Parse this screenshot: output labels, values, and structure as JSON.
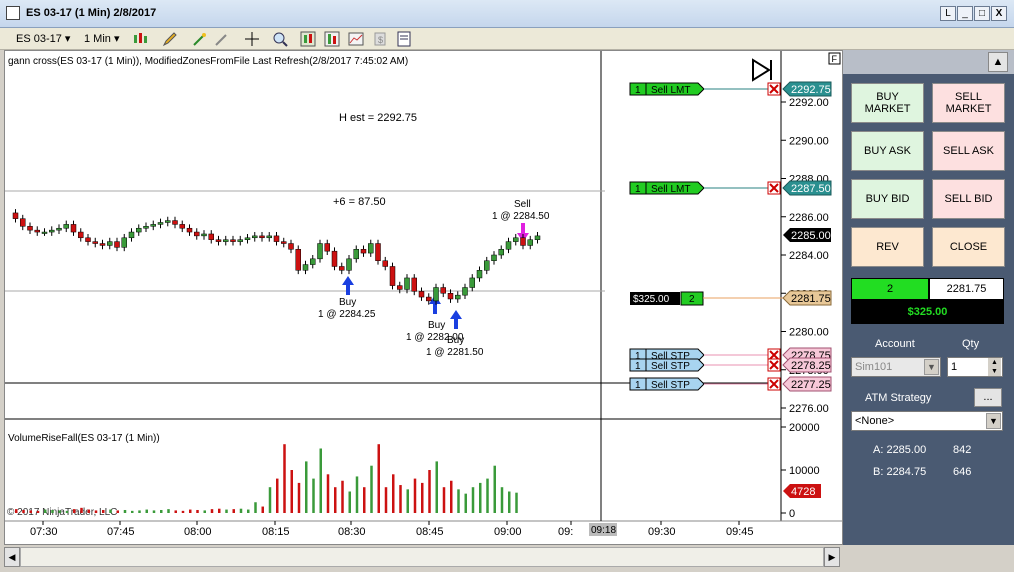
{
  "window": {
    "title": "ES 03-17 (1 Min)  2/8/2017",
    "btn_restore": "L",
    "btn_min": "_",
    "btn_max": "□",
    "btn_close": "X"
  },
  "toolbar": {
    "instrument": "ES 03-17",
    "interval": "1 Min"
  },
  "chart": {
    "header": "gann cross(ES 03-17 (1 Min)), ModifiedZonesFromFile Last Refresh(2/8/2017 7:45:02 AM)",
    "corner_label": "F",
    "annotations": {
      "h_est": "H est = 2292.75",
      "plus6": "+6 = 87.50",
      "sell_line1": "Sell",
      "sell_line2": "1 @ 2284.50",
      "buy1_line1": "Buy",
      "buy1_line2": "1 @ 2284.25",
      "buy2_line1": "Buy",
      "buy2_line2": "1 @ 2282.00",
      "buy3_line1": "Buy",
      "buy3_line2": "1 @ 2281.50"
    },
    "volume_label": "VolumeRiseFall(ES 03-17 (1 Min))",
    "copyright": "© 2017 NinjaTrader, LLC",
    "price_ticks": [
      "2292.00",
      "2290.00",
      "2288.00",
      "2286.00",
      "2284.00",
      "2282.00",
      "2280.00",
      "2278.00",
      "2276.00"
    ],
    "volume_ticks": [
      "20000",
      "10000",
      "0"
    ],
    "time_ticks": [
      "07:30",
      "07:45",
      "08:00",
      "08:15",
      "08:30",
      "08:45",
      "09:00",
      "09:",
      "09:30",
      "09:45"
    ],
    "crosshair_time": "09:18",
    "current_price": "2285.00",
    "current_volume": "4728",
    "orders": [
      {
        "qty": "1",
        "label": "Sell LMT",
        "price": "2292.75",
        "kind": "lmt"
      },
      {
        "qty": "1",
        "label": "Sell LMT",
        "price": "2287.50",
        "kind": "lmt"
      },
      {
        "qty": "1",
        "label": "Sell STP",
        "price": "2278.75",
        "kind": "stp"
      },
      {
        "qty": "1",
        "label": "Sell STP",
        "price": "2278.25",
        "kind": "stp"
      },
      {
        "qty": "1",
        "label": "Sell STP",
        "price": "2277.25",
        "kind": "stp"
      }
    ],
    "position": {
      "pnl": "$325.00",
      "qty": "2",
      "price": "2281.75"
    }
  },
  "panel": {
    "buy_market": "BUY MARKET",
    "sell_market": "SELL MARKET",
    "buy_ask": "BUY ASK",
    "sell_ask": "SELL ASK",
    "buy_bid": "BUY BID",
    "sell_bid": "SELL BID",
    "rev": "REV",
    "close": "CLOSE",
    "position_qty": "2",
    "position_price": "2281.75",
    "position_pnl": "$325.00",
    "account_label": "Account",
    "qty_label": "Qty",
    "account_value": "Sim101",
    "qty_value": "1",
    "atm_label": "ATM Strategy",
    "atm_btn": "...",
    "atm_value": "<None>",
    "ask_label": "A: 2285.00",
    "ask_size": "842",
    "bid_label": "B: 2284.75",
    "bid_size": "646"
  },
  "colors": {
    "up_candle": "#3a9a3a",
    "down_candle": "#cc1111",
    "lmt_tag": "#22cc22",
    "stp_tag": "#a8d4f0",
    "price_box": "#2a9090"
  }
}
